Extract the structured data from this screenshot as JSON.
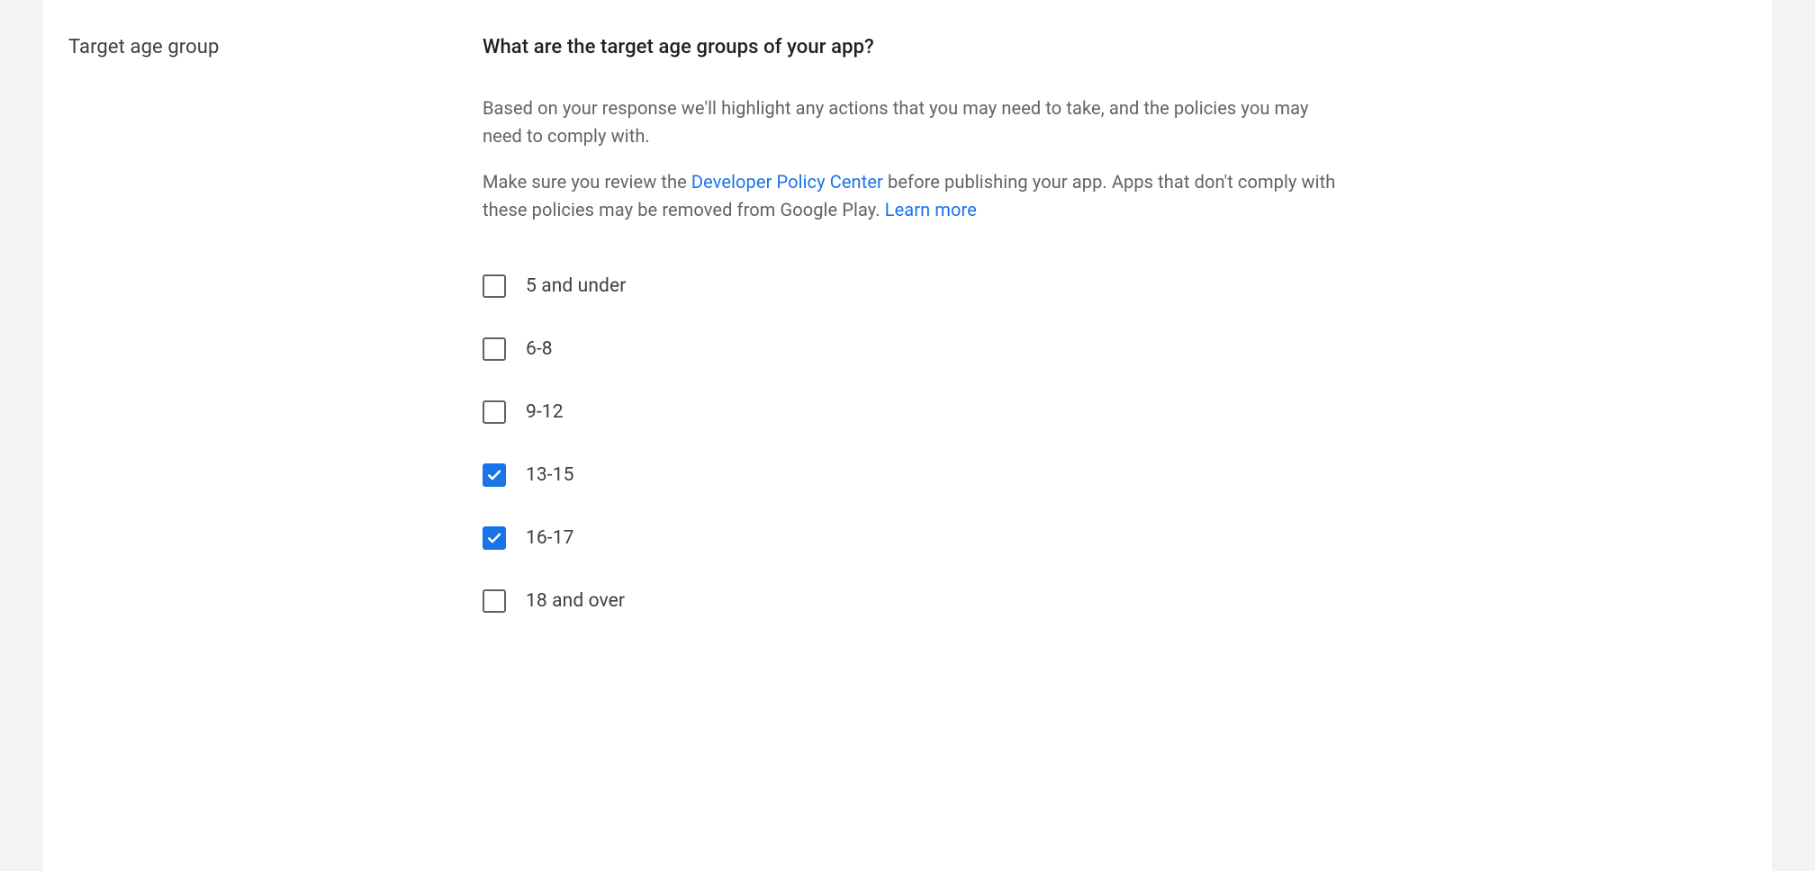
{
  "section": {
    "label": "Target age group"
  },
  "question": {
    "heading": "What are the target age groups of your app?",
    "desc1": "Based on your response we'll highlight any actions that you may need to take, and the policies you may need to comply with.",
    "desc2_pre": "Make sure you review the ",
    "desc2_link1": "Developer Policy Center",
    "desc2_mid": " before publishing your app. Apps that don't comply with these policies may be removed from Google Play. ",
    "desc2_link2": "Learn more"
  },
  "options": [
    {
      "label": "5 and under",
      "checked": false
    },
    {
      "label": "6-8",
      "checked": false
    },
    {
      "label": "9-12",
      "checked": false
    },
    {
      "label": "13-15",
      "checked": true
    },
    {
      "label": "16-17",
      "checked": true
    },
    {
      "label": "18 and over",
      "checked": false
    }
  ]
}
